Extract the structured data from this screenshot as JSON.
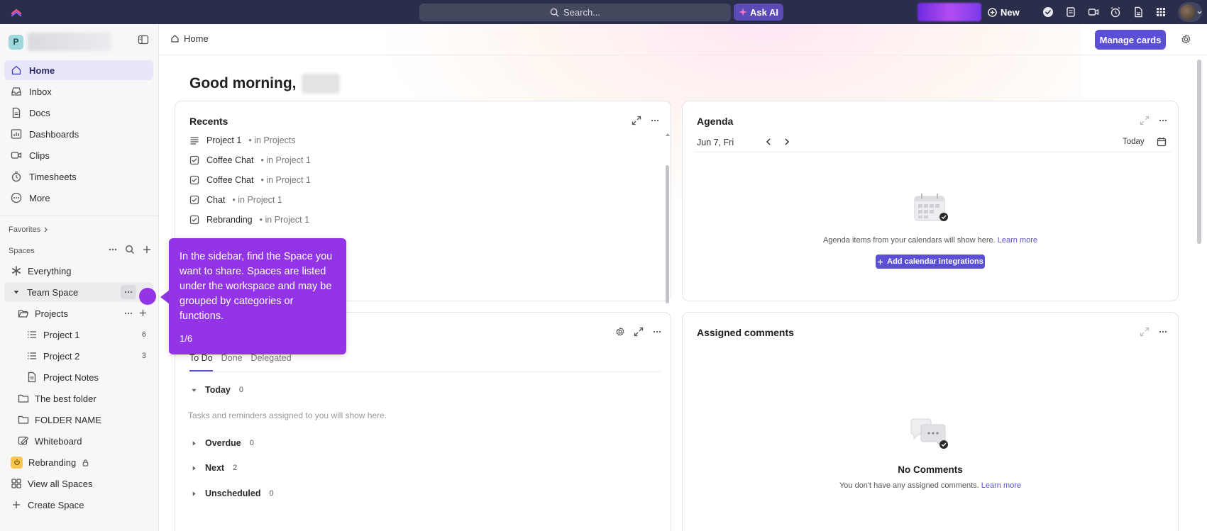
{
  "topbar": {
    "search_placeholder": "Search...",
    "ask_ai_label": "Ask AI",
    "new_label": "New"
  },
  "sidebar": {
    "workspace_initial": "P",
    "nav": [
      {
        "label": "Home",
        "icon": "home-icon",
        "active": true
      },
      {
        "label": "Inbox",
        "icon": "inbox-icon"
      },
      {
        "label": "Docs",
        "icon": "doc-icon"
      },
      {
        "label": "Dashboards",
        "icon": "dashboard-icon"
      },
      {
        "label": "Clips",
        "icon": "video-icon"
      },
      {
        "label": "Timesheets",
        "icon": "timer-icon"
      },
      {
        "label": "More",
        "icon": "more-circle-icon"
      }
    ],
    "favorites_label": "Favorites",
    "spaces_label": "Spaces",
    "tree": {
      "everything": "Everything",
      "team_space": "Team Space",
      "projects": "Projects",
      "project1": "Project 1",
      "project1_count": "6",
      "project2": "Project 2",
      "project2_count": "3",
      "project_notes": "Project Notes",
      "best_folder": "The best folder",
      "folder_name": "FOLDER NAME",
      "whiteboard": "Whiteboard",
      "rebranding": "Rebranding",
      "view_all": "View all Spaces",
      "create": "Create Space"
    }
  },
  "main": {
    "breadcrumb": "Home",
    "manage_cards": "Manage cards",
    "greeting": "Good morning,",
    "recents": {
      "title": "Recents",
      "items": [
        {
          "name": "Project 1",
          "loc": "• in Projects",
          "icon": "list-icon"
        },
        {
          "name": "Coffee Chat",
          "loc": "• in Project 1",
          "icon": "task-icon"
        },
        {
          "name": "Coffee Chat",
          "loc": "• in Project 1",
          "icon": "task-icon"
        },
        {
          "name": "Chat",
          "loc": "• in Project 1",
          "icon": "task-icon"
        },
        {
          "name": "Rebranding",
          "loc": "• in Project 1",
          "icon": "task-icon"
        }
      ]
    },
    "agenda": {
      "title": "Agenda",
      "date": "Jun 7, Fri",
      "today": "Today",
      "empty_text": "Agenda items from your calendars will show here.",
      "learn_more": "Learn more",
      "add_btn": "Add calendar integrations"
    },
    "my_work": {
      "tabs": [
        "To Do",
        "Done",
        "Delegated"
      ],
      "groups": [
        {
          "label": "Today",
          "count": "0"
        },
        {
          "label": "Overdue",
          "count": "0"
        },
        {
          "label": "Next",
          "count": "2"
        },
        {
          "label": "Unscheduled",
          "count": "0"
        }
      ],
      "empty_text": "Tasks and reminders assigned to you will show here."
    },
    "comments": {
      "title": "Assigned comments",
      "empty_title": "No Comments",
      "empty_text": "You don't have any assigned comments.",
      "learn_more": "Learn more"
    }
  },
  "tooltip": {
    "text": "In the sidebar, find the Space you want to share. Spaces are listed under the workspace and may be grouped by categories or functions.",
    "step": "1/6"
  },
  "colors": {
    "topbar": "#2a2e4b",
    "accent": "#5b4fd6",
    "tooltip": "#9334e6"
  }
}
